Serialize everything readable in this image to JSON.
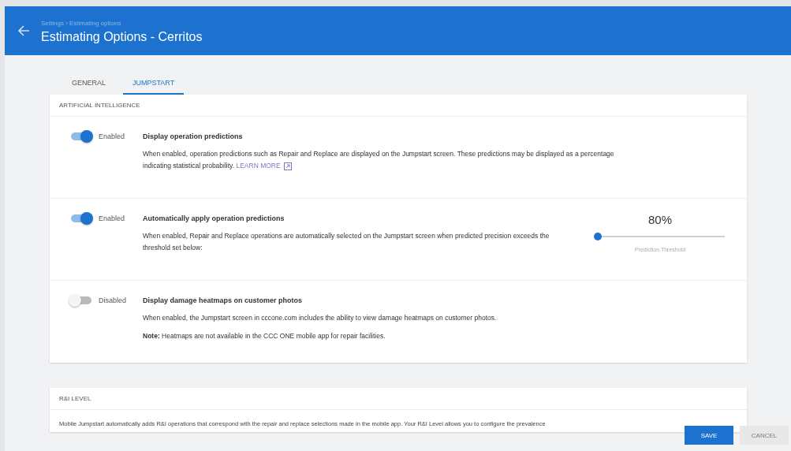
{
  "header": {
    "breadcrumb": "Settings › Estimating options",
    "title": "Estimating Options - Cerritos"
  },
  "tabs": [
    {
      "label": "GENERAL",
      "selected": false
    },
    {
      "label": "JUMPSTART",
      "selected": true
    }
  ],
  "ai_section": {
    "title": "ARTIFICIAL INTELLIGENCE",
    "settings": [
      {
        "kind": "link",
        "on": true,
        "status": "Enabled",
        "title": "Display operation predictions",
        "description": "When enabled, operation predictions such as Repair and Replace are displayed on the Jumpstart screen. These predictions may be displayed as a percentage indicating statistical probability.",
        "link": "LEARN MORE"
      },
      {
        "kind": "slider",
        "on": true,
        "status": "Enabled",
        "title": "Automatically apply operation predictions",
        "description": "When enabled, Repair and Replace operations are automatically selected on the Jumpstart screen when predicted precision exceeds the threshold set below:",
        "reading": "80%",
        "level": 0.02,
        "slider_label": "Prediction Threshold"
      },
      {
        "kind": "note",
        "on": false,
        "status": "Disabled",
        "title": "Display damage heatmaps on customer photos",
        "description": "When enabled, the Jumpstart screen in cccone.com includes the ability to view damage heatmaps on customer photos.",
        "note": "**Note:** Heatmaps are not available in the CCC ONE mobile app for repair facilities."
      }
    ]
  },
  "ri_section": {
    "title": "R&I LEVEL",
    "description": "Mobile Jumpstart automatically adds R&I operations that correspond with the repair and replace selections made in the mobile app. Your R&I Level allows you to configure the prevalence"
  },
  "buttons": [
    {
      "label": "SAVE",
      "kind": "primary"
    },
    {
      "label": "CANCEL",
      "kind": "secondary"
    }
  ]
}
